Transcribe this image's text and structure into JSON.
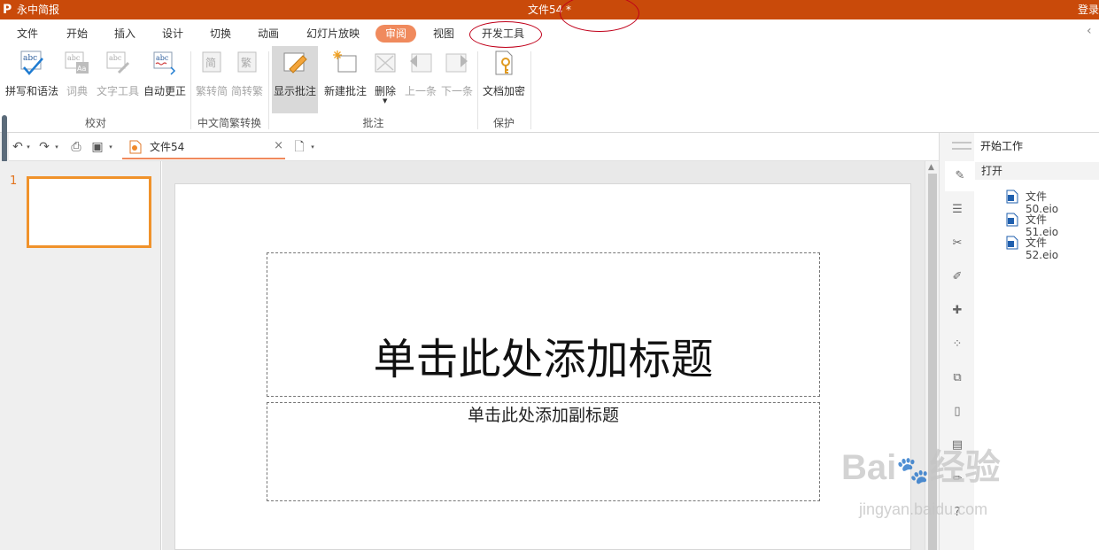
{
  "titlebar": {
    "logo": "P",
    "app_name": "永中简报",
    "doc_title": "文件54 *",
    "login": "登录"
  },
  "menu": {
    "items": [
      "文件",
      "开始",
      "插入",
      "设计",
      "切换",
      "动画",
      "幻灯片放映",
      "审阅",
      "视图",
      "开发工具"
    ],
    "active": "审阅"
  },
  "ribbon": {
    "buttons": {
      "spell": "拼写和语法",
      "dict": "词典",
      "text_tools": "文字工具",
      "autocorrect": "自动更正",
      "trad_to_simp": "繁转简",
      "simp_to_trad": "简转繁",
      "show_comments": "显示批注",
      "new_comment": "新建批注",
      "delete": "删除",
      "prev": "上一条",
      "next": "下一条",
      "encrypt": "文档加密"
    },
    "groups": {
      "proofing": "校对",
      "chinese_conv": "中文简繁转换",
      "comments": "批注",
      "protect": "保护"
    },
    "icon_texts": {
      "abc": "abc",
      "aa": "Aa",
      "jian": "简",
      "fan": "繁"
    }
  },
  "toolbar": {
    "doc_tab": "文件54"
  },
  "thumbnails": {
    "slide_number": "1"
  },
  "slide": {
    "title_placeholder": "单击此处添加标题",
    "subtitle_placeholder": "单击此处添加副标题"
  },
  "right_panel": {
    "header": "开始工作",
    "open": "打开",
    "recent_files": [
      "文件50.eio",
      "文件51.eio",
      "文件52.eio"
    ]
  },
  "watermark": {
    "brand": "Bai",
    "brand_cn": "经验",
    "url": "jingyan.baidu.com"
  },
  "colors": {
    "titlebar": "#c94a0a",
    "active_tab": "#f08a5d",
    "thumb_border": "#f0922b",
    "annotation": "#c0001a"
  }
}
